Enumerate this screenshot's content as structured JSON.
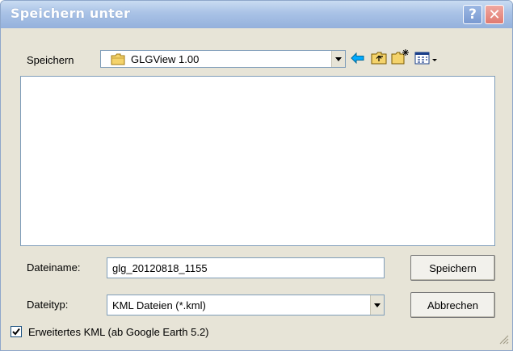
{
  "window": {
    "title": "Speichern unter"
  },
  "titlebar": {
    "help_label": "?",
    "close_label": "✕"
  },
  "location": {
    "label": "Speichern",
    "value": "GLGView 1.00",
    "icons": [
      "folder-icon",
      "back-arrow-icon",
      "up-folder-icon",
      "new-folder-icon",
      "view-menu-icon"
    ]
  },
  "filename": {
    "label": "Dateiname:",
    "value": "glg_20120818_1155"
  },
  "filetype": {
    "label": "Dateityp:",
    "value": "KML Dateien (*.kml)"
  },
  "buttons": {
    "save": "Speichern",
    "cancel": "Abbrechen"
  },
  "extended_kml": {
    "label": "Erweitertes KML (ab Google Earth 5.2)",
    "checked": true
  },
  "colors": {
    "title_text": "#ffffff",
    "titlebar": "#a9c2e6",
    "dialog_bg": "#e7e4d7",
    "field_border": "#7f9db9",
    "back_arrow": "#00aaff"
  }
}
